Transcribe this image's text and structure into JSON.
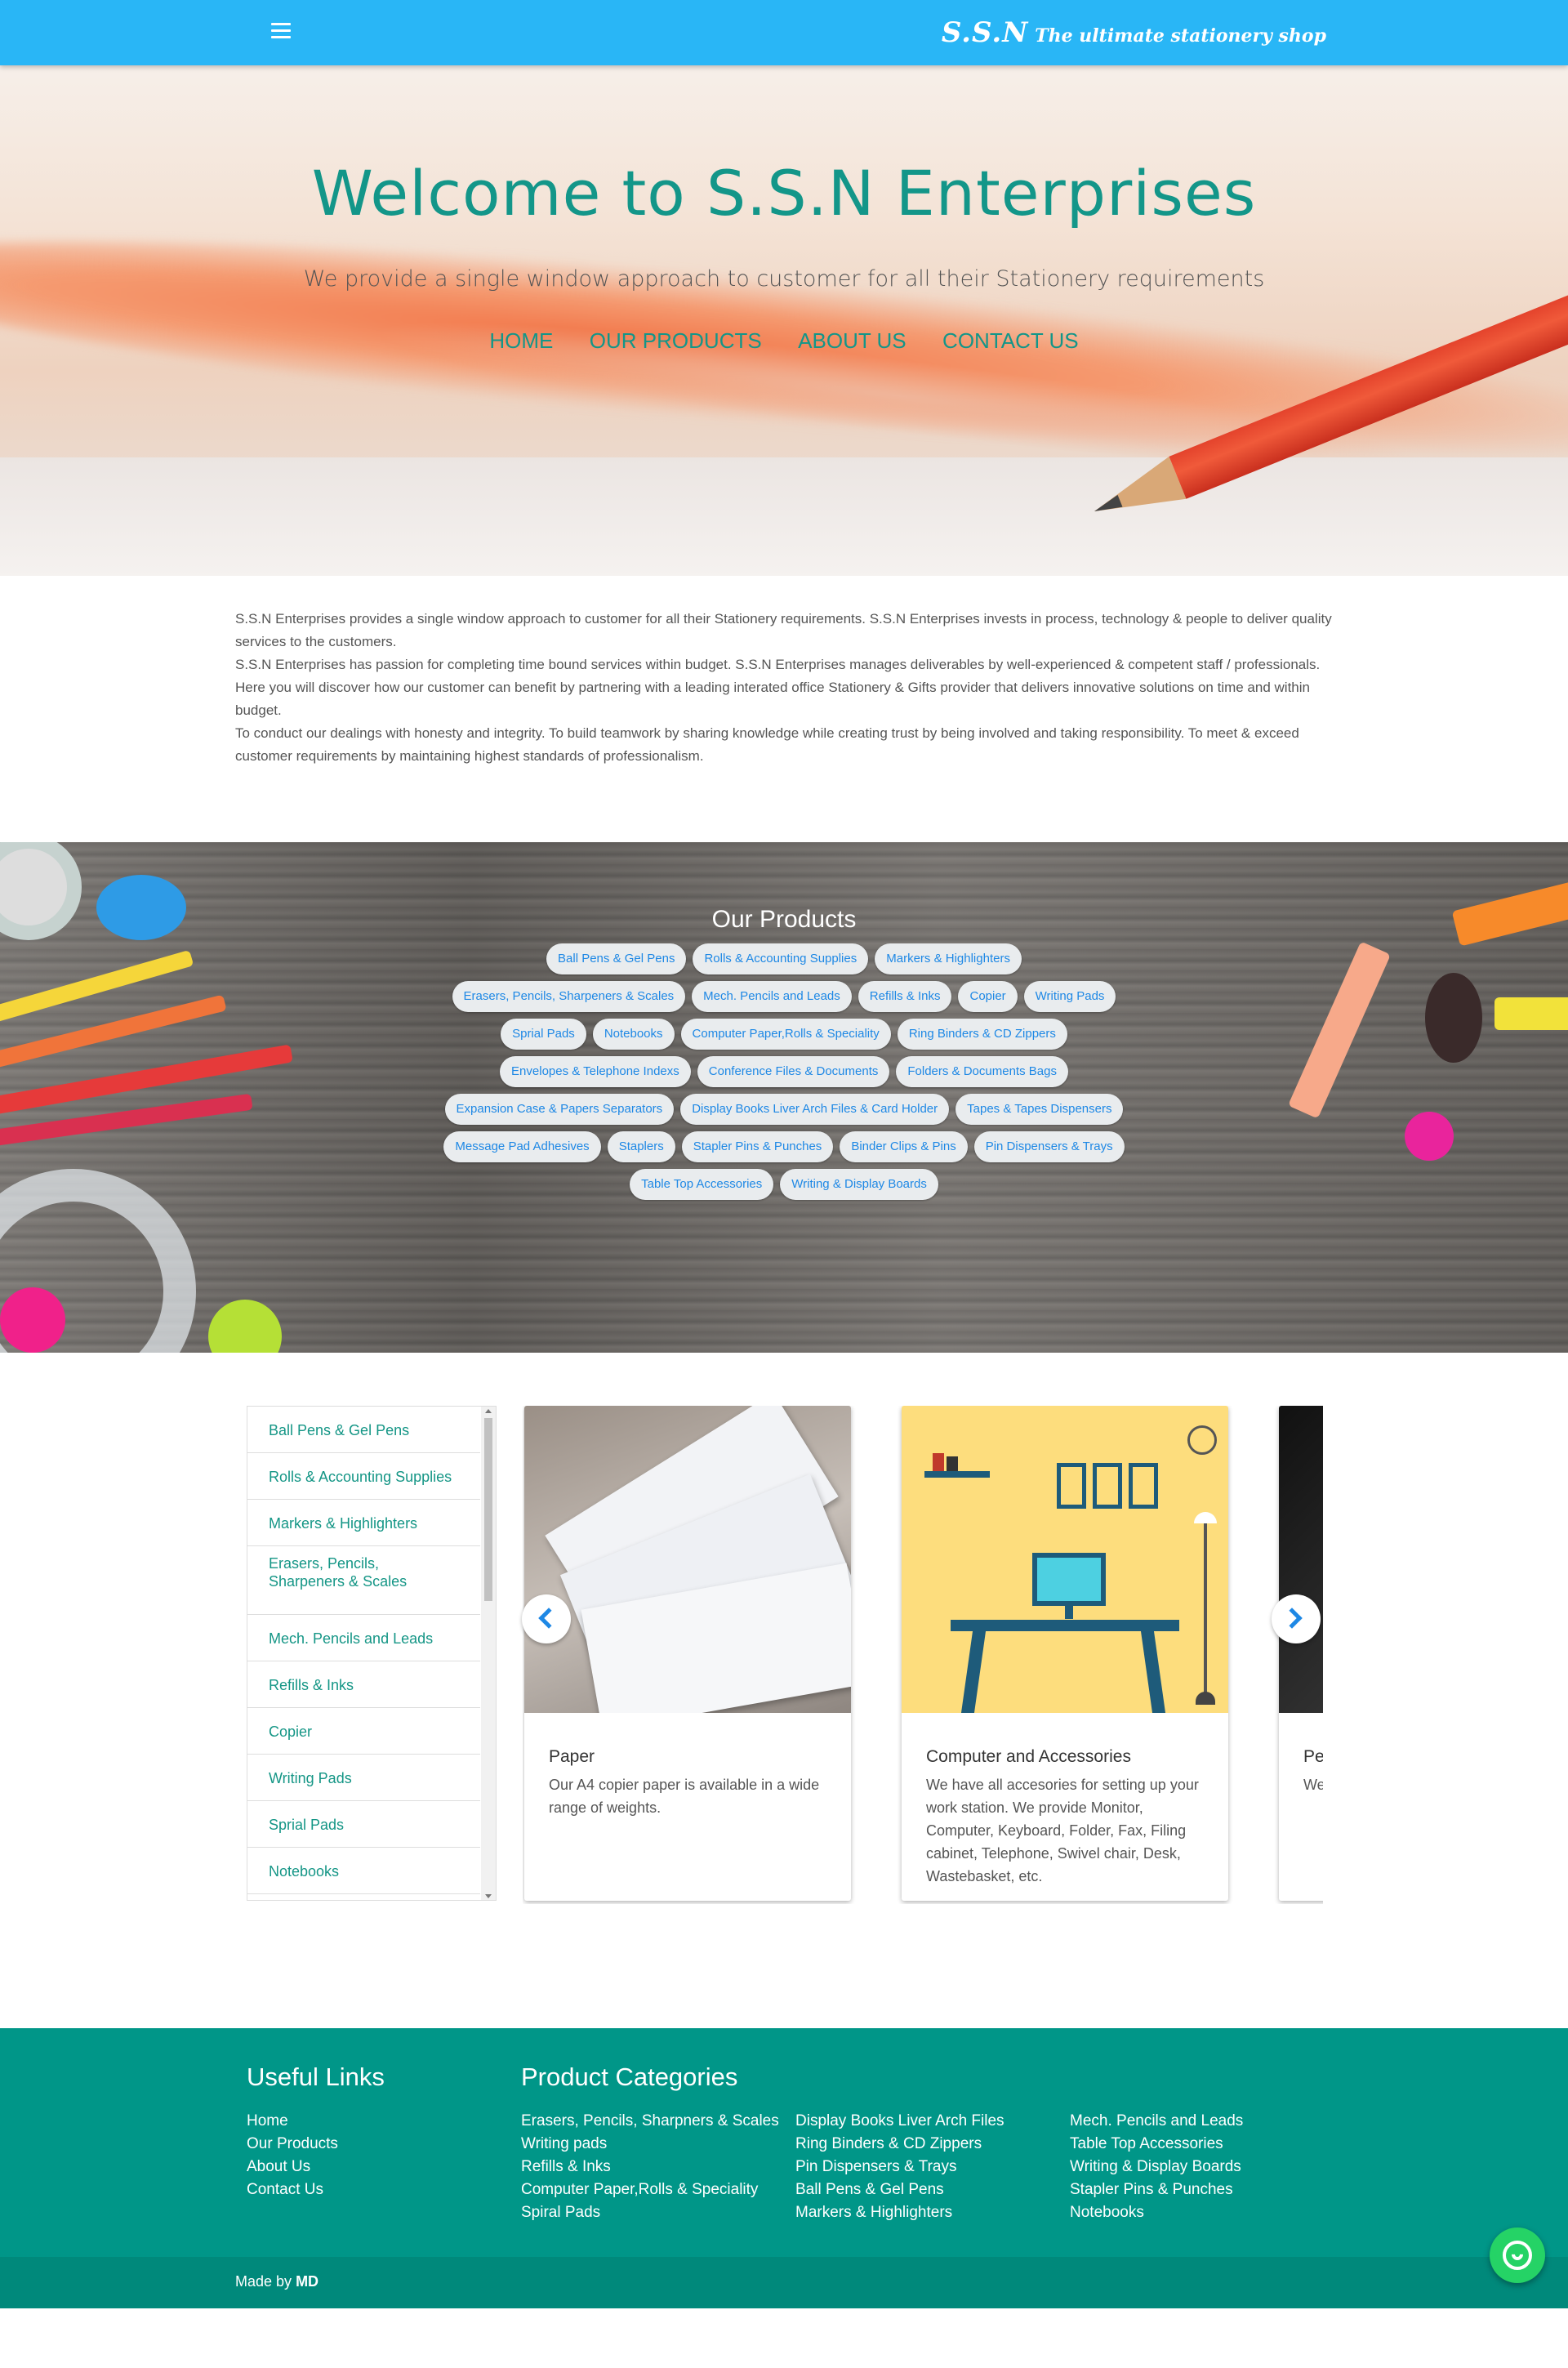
{
  "topbar": {
    "brand_name": "S.S.N",
    "brand_tagline": "The ultimate stationery shop",
    "menu_icon": "hamburger-menu-icon"
  },
  "hero": {
    "title": "Welcome to S.S.N Enterprises",
    "subtitle": "We provide a single window approach to customer for all their Stationery requirements",
    "nav": [
      "HOME",
      "OUR PRODUCTS",
      "ABOUT US",
      "CONTACT US"
    ]
  },
  "about": {
    "paragraphs": [
      "S.S.N Enterprises provides a single window approach to customer for all their Stationery requirements. S.S.N Enterprises invests in process, technology & people to deliver quality services to the customers.",
      "S.S.N Enterprises has passion for completing time bound services within budget. S.S.N Enterprises manages deliverables by well-experienced & competent staff / professionals.",
      "Here you will discover how our customer can benefit by partnering with a leading interated office Stationery & Gifts provider that delivers innovative solutions on time and within budget.",
      "To conduct our dealings with honesty and integrity. To build teamwork by sharing knowledge while creating trust by being involved and taking responsibility. To meet & exceed customer requirements by maintaining highest standards of professionalism."
    ]
  },
  "products": {
    "title": "Our Products",
    "chips": [
      "Ball Pens & Gel Pens",
      "Rolls & Accounting Supplies",
      "Markers & Highlighters",
      "Erasers, Pencils, Sharpeners & Scales",
      "Mech. Pencils and Leads",
      "Refills & Inks",
      "Copier",
      "Writing Pads",
      "Sprial Pads",
      "Notebooks",
      "Computer Paper,Rolls & Speciality",
      "Ring Binders & CD Zippers",
      "Envelopes & Telephone Indexs",
      "Conference Files & Documents",
      "Folders & Documents Bags",
      "Expansion Case & Papers Separators",
      "Display Books Liver Arch Files & Card Holder",
      "Tapes & Tapes Dispensers",
      "Message Pad Adhesives",
      "Staplers",
      "Stapler Pins & Punches",
      "Binder Clips & Pins",
      "Pin Dispensers & Trays",
      "Table Top Accessories",
      "Writing & Display Boards"
    ]
  },
  "sidebar": {
    "items": [
      "Ball Pens & Gel Pens",
      "Rolls & Accounting Supplies",
      "Markers & Highlighters",
      "Erasers, Pencils, Sharpeners & Scales",
      "Mech. Pencils and Leads",
      "Refills & Inks",
      "Copier",
      "Writing Pads",
      "Sprial Pads",
      "Notebooks"
    ]
  },
  "carousel": {
    "cards": [
      {
        "title": "Paper",
        "text": "Our A4 copier paper is available in a wide range of weights."
      },
      {
        "title": "Computer and Accessories",
        "text": "We have all accesories for setting up your work station. We provide Monitor, Computer, Keyboard, Folder, Fax, Filing cabinet, Telephone, Swivel chair, Desk, Wastebasket, etc."
      },
      {
        "title": "Pe",
        "text": "We Fo"
      }
    ]
  },
  "footer": {
    "useful_title": "Useful Links",
    "useful_links": [
      "Home",
      "Our Products",
      "About Us",
      "Contact Us"
    ],
    "categories_title": "Product Categories",
    "col1": [
      "Erasers, Pencils, Sharpners & Scales",
      "Writing pads",
      "Refills & Inks",
      "Computer Paper,Rolls & Speciality",
      "Spiral Pads"
    ],
    "col2": [
      "Display Books Liver Arch Files",
      "Ring Binders & CD Zippers",
      "Pin Dispensers & Trays",
      "Ball Pens & Gel Pens",
      "Markers & Highlighters"
    ],
    "col3": [
      "Mech. Pencils and Leads",
      "Table Top Accessories",
      "Writing & Display Boards",
      "Stapler Pins & Punches",
      "Notebooks"
    ],
    "made_by": "Made by",
    "author": "MD"
  },
  "colors": {
    "topbar": "#29b6f6",
    "accent": "#139689",
    "footer": "#009688",
    "chip_text": "#1e88e5",
    "whatsapp": "#25d366"
  }
}
